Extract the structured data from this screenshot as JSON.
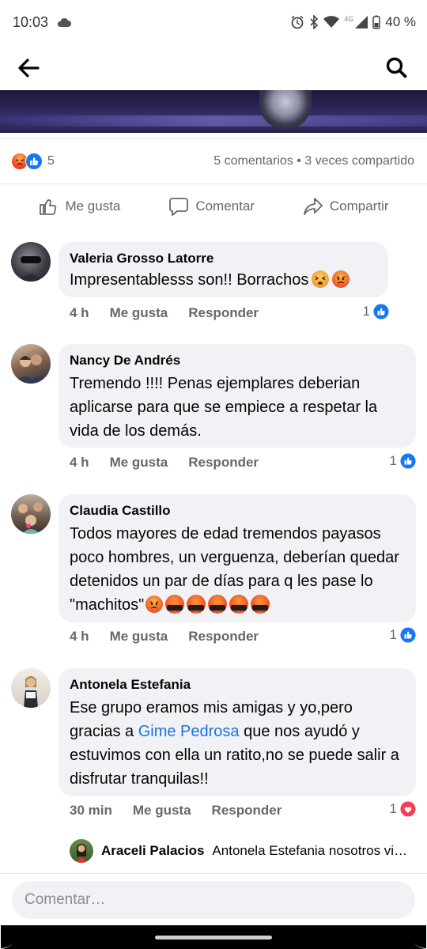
{
  "status": {
    "time": "10:03",
    "network": "4G",
    "battery": "40 %"
  },
  "post": {
    "reactions_count": "5",
    "stats": "5 comentarios • 3 veces compartido",
    "actions": {
      "like": "Me gusta",
      "comment": "Comentar",
      "share": "Compartir"
    }
  },
  "comments": [
    {
      "author": "Valeria Grosso Latorre",
      "text": "Impresentablesss son!! Borrachos",
      "time": "4 h",
      "like": "Me gusta",
      "reply": "Responder",
      "likes": "1"
    },
    {
      "author": "Nancy De Andrés",
      "text": "Tremendo !!!! Penas ejemplares deberian aplicarse para que se empiece a respetar la vida de los demás.",
      "time": "4 h",
      "like": "Me gusta",
      "reply": "Responder",
      "likes": "1"
    },
    {
      "author": "Claudia Castillo",
      "text": "Todos mayores de edad tremendos payasos poco hombres, un verguenza, deberían quedar detenidos un par de días para q les pase lo \"machitos\"",
      "time": "4 h",
      "like": "Me gusta",
      "reply": "Responder",
      "likes": "1"
    },
    {
      "author": "Antonela Estefania",
      "text_before": "Ese grupo eramos mis amigas y yo,pero gracias a ",
      "mention": "Gime Pedrosa",
      "text_after": "  que nos ayudó y estuvimos con ella un ratito,no se puede salir a disfrutar tranquilas!!",
      "time": "30 min",
      "like": "Me gusta",
      "reply": "Responder",
      "likes": "1"
    }
  ],
  "reply_preview": {
    "author": "Araceli Palacios",
    "text": "Antonela Estefania nosotros vi…"
  },
  "composer": {
    "placeholder": "Comentar…"
  }
}
